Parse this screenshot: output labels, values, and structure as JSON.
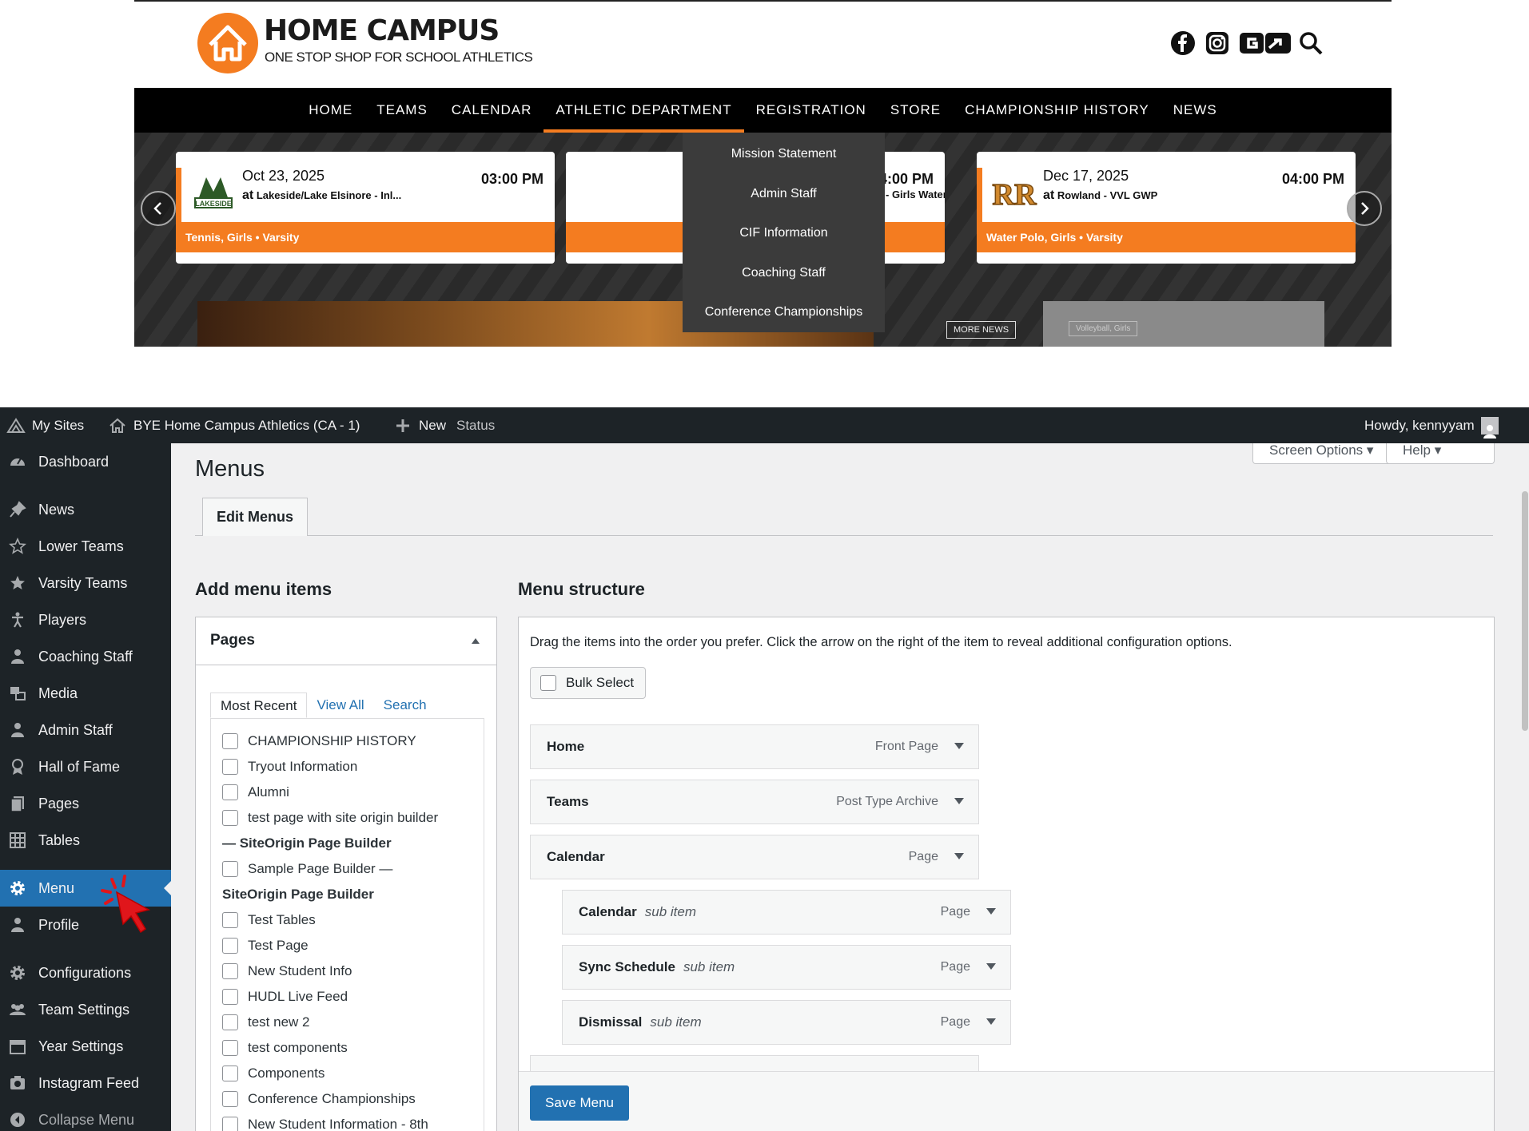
{
  "site": {
    "logo_title": "HOME CAMPUS",
    "logo_subtitle": "ONE STOP SHOP FOR SCHOOL ATHLETICS",
    "social_icons": [
      "facebook-icon",
      "instagram-icon",
      "gofan-icon",
      "search-icon"
    ],
    "nav": [
      "HOME",
      "TEAMS",
      "CALENDAR",
      "ATHLETIC DEPARTMENT",
      "REGISTRATION",
      "STORE",
      "CHAMPIONSHIP HISTORY",
      "NEWS"
    ],
    "dropdown": [
      "Mission Statement",
      "Admin Staff",
      "CIF Information",
      "Coaching Staff",
      "Conference Championships"
    ],
    "cards": [
      {
        "date": "Oct 23, 2025",
        "time": "03:00 PM",
        "at": "at",
        "location": "Lakeside/Lake Elsinore - Inl...",
        "sport": "Tennis, Girls • Varsity",
        "logo_text": "LAKESIDE"
      },
      {
        "date": "",
        "time": "04:00 PM",
        "at": "",
        "location": "- Girls Water ...",
        "sport": "",
        "logo_text": ""
      },
      {
        "date": "Dec 17, 2025",
        "time": "04:00 PM",
        "at": "at",
        "location": "Rowland - VVL GWP",
        "sport": "Water Polo, Girls • Varsity",
        "logo_text": "RR"
      }
    ],
    "more_news": "MORE NEWS",
    "volleyball_tag": "Volleyball, Girls"
  },
  "adminbar": {
    "my_sites": "My Sites",
    "site_name": "BYE Home Campus Athletics (CA - 1)",
    "new": "New",
    "status": "Status",
    "howdy": "Howdy, kennyyam"
  },
  "sidebar": [
    {
      "label": "Dashboard",
      "icon": "dashboard-icon"
    },
    {
      "label": "News",
      "icon": "pin-icon"
    },
    {
      "label": "Lower Teams",
      "icon": "star-outline-icon"
    },
    {
      "label": "Varsity Teams",
      "icon": "star-filled-icon"
    },
    {
      "label": "Players",
      "icon": "person-icon"
    },
    {
      "label": "Coaching Staff",
      "icon": "user-icon"
    },
    {
      "label": "Media",
      "icon": "media-icon"
    },
    {
      "label": "Admin Staff",
      "icon": "user-icon"
    },
    {
      "label": "Hall of Fame",
      "icon": "award-icon"
    },
    {
      "label": "Pages",
      "icon": "pages-icon"
    },
    {
      "label": "Tables",
      "icon": "table-icon"
    },
    {
      "label": "Menu",
      "icon": "gear-icon"
    },
    {
      "label": "Profile",
      "icon": "user-icon"
    },
    {
      "label": "Configurations",
      "icon": "gear-icon"
    },
    {
      "label": "Team Settings",
      "icon": "group-icon"
    },
    {
      "label": "Year Settings",
      "icon": "calendar-icon"
    },
    {
      "label": "Instagram Feed",
      "icon": "camera-icon"
    },
    {
      "label": "Collapse Menu",
      "icon": "collapse-icon"
    }
  ],
  "content": {
    "screen_options": "Screen Options",
    "help": "Help",
    "page_title": "Menus",
    "tab": "Edit Menus",
    "add_items_heading": "Add menu items",
    "structure_heading": "Menu structure",
    "pages_box": {
      "title": "Pages",
      "tabs": [
        "Most Recent",
        "View All",
        "Search"
      ],
      "items": [
        {
          "label": "CHAMPIONSHIP HISTORY",
          "checkbox": true
        },
        {
          "label": "Tryout Information",
          "checkbox": true
        },
        {
          "label": "Alumni",
          "checkbox": true
        },
        {
          "label": "test page with site origin builder",
          "checkbox": true
        },
        {
          "label": "— SiteOrigin Page Builder",
          "checkbox": false
        },
        {
          "label": "Sample Page Builder —",
          "checkbox": true
        },
        {
          "label": "SiteOrigin Page Builder",
          "checkbox": false
        },
        {
          "label": "Test Tables",
          "checkbox": true
        },
        {
          "label": "Test Page",
          "checkbox": true
        },
        {
          "label": "New Student Info",
          "checkbox": true
        },
        {
          "label": "HUDL Live Feed",
          "checkbox": true
        },
        {
          "label": "test new 2",
          "checkbox": true
        },
        {
          "label": "test components",
          "checkbox": true
        },
        {
          "label": "Components",
          "checkbox": true
        },
        {
          "label": "Conference Championships",
          "checkbox": true
        },
        {
          "label": "New Student Information - 8th",
          "checkbox": true
        }
      ]
    },
    "structure": {
      "description": "Drag the items into the order you prefer. Click the arrow on the right of the item to reveal additional configuration options.",
      "bulk_select": "Bulk Select",
      "items": [
        {
          "title": "Home",
          "sub": "",
          "type": "Front Page",
          "depth": 0
        },
        {
          "title": "Teams",
          "sub": "",
          "type": "Post Type Archive",
          "depth": 0
        },
        {
          "title": "Calendar",
          "sub": "",
          "type": "Page",
          "depth": 0
        },
        {
          "title": "Calendar",
          "sub": "sub item",
          "type": "Page",
          "depth": 1
        },
        {
          "title": "Sync Schedule",
          "sub": "sub item",
          "type": "Page",
          "depth": 1
        },
        {
          "title": "Dismissal",
          "sub": "sub item",
          "type": "Page",
          "depth": 1
        }
      ],
      "save_button": "Save Menu"
    }
  },
  "colors": {
    "brand_orange": "#f47c20",
    "wp_blue": "#2271b1",
    "admin_dark": "#1d2327",
    "cursor_red": "#e0161b"
  }
}
